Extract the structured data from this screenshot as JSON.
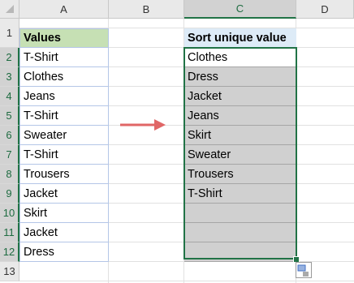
{
  "columns": [
    "A",
    "B",
    "C",
    "D"
  ],
  "rows": [
    "1",
    "2",
    "3",
    "4",
    "5",
    "6",
    "7",
    "8",
    "9",
    "10",
    "11",
    "12",
    "13"
  ],
  "colors": {
    "values_header": "#c6e0b4",
    "sort_header": "#ddebf7",
    "selection": "#217346",
    "shade": "#d0d0d0",
    "arrow": "#e06666"
  },
  "sheet": {
    "col_a_header": "Values",
    "col_a_values": [
      "T-Shirt",
      "Clothes",
      "Jeans",
      "T-Shirt",
      "Sweater",
      "T-Shirt",
      "Trousers",
      "Jacket",
      "Skirt",
      "Jacket",
      "Dress"
    ],
    "col_c_header": "Sort unique value",
    "col_c_values": [
      "Clothes",
      "Dress",
      "Jacket",
      "Jeans",
      "Skirt",
      "Sweater",
      "Trousers",
      "T-Shirt",
      "",
      "",
      ""
    ]
  },
  "arrow_icon": "right-arrow-icon",
  "paste_options_icon": "quick-analysis-icon"
}
